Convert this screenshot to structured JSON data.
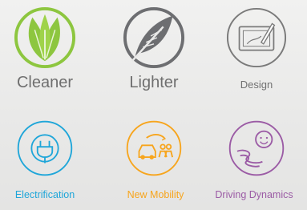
{
  "features": [
    {
      "label": "Cleaner",
      "icon": "leaf-icon",
      "color": "#8dc63f"
    },
    {
      "label": "Lighter",
      "icon": "feather-icon",
      "color": "#6d6e71"
    },
    {
      "label": "Design",
      "icon": "design-tablet-icon",
      "color": "#7a7a7a"
    }
  ],
  "capabilities": [
    {
      "label": "Electrification",
      "icon": "plug-icon",
      "color": "#1fa6d9"
    },
    {
      "label": "New Mobility",
      "icon": "car-sharing-icon",
      "color": "#f7a51d"
    },
    {
      "label": "Driving Dynamics",
      "icon": "winding-road-smile-icon",
      "color": "#9b5ba5"
    }
  ]
}
